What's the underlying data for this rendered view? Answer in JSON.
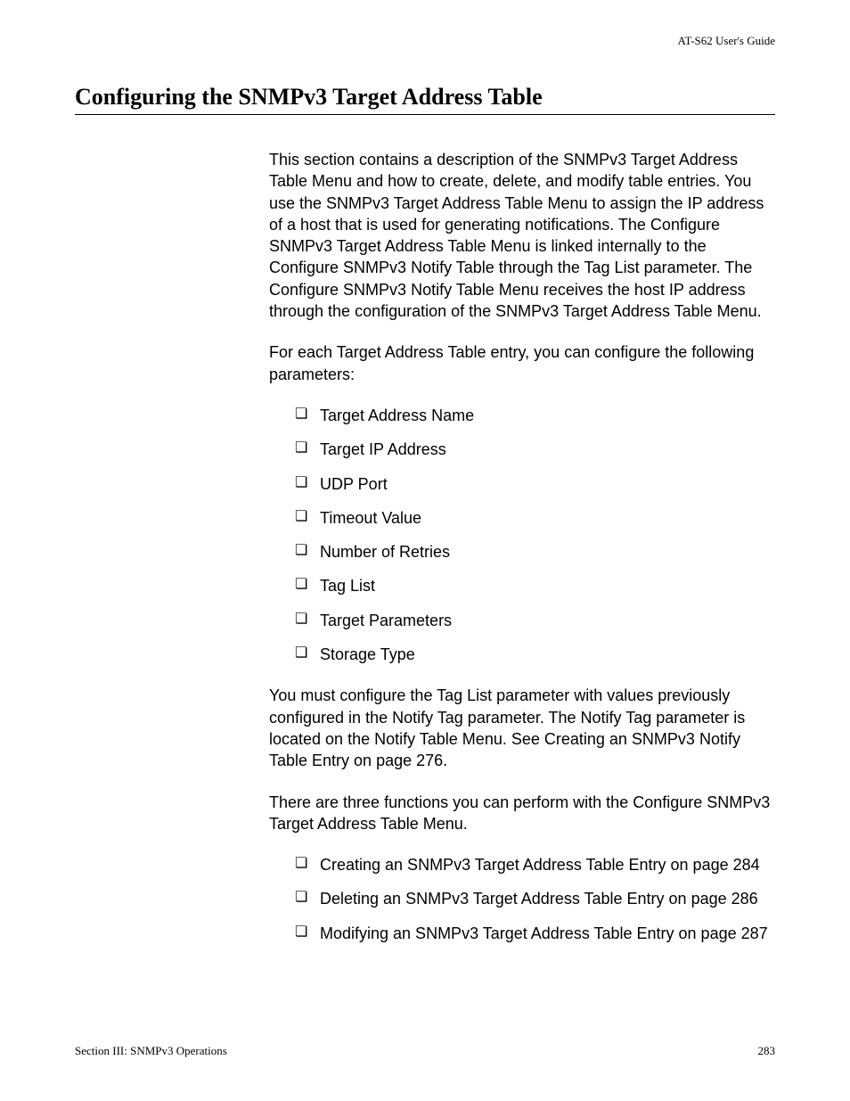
{
  "header": {
    "guide_title": "AT-S62 User's Guide"
  },
  "heading": "Configuring the SNMPv3 Target Address Table",
  "paragraphs": {
    "intro": "This section contains a description of the SNMPv3 Target Address Table Menu and how to create, delete, and modify table entries. You use the SNMPv3 Target Address Table Menu to assign the IP address of a host that is used for generating notifications. The Configure SNMPv3 Target Address Table Menu is linked internally to the Configure SNMPv3 Notify Table through the Tag List parameter. The Configure SNMPv3 Notify Table Menu receives the host IP address through the configuration of the SNMPv3 Target Address Table Menu.",
    "params_intro": "For each Target Address Table entry, you can configure the following parameters:",
    "tag_list_note": "You must configure the Tag List parameter with values previously configured in the Notify Tag parameter. The Notify Tag parameter is located on the Notify Table Menu. See Creating an SNMPv3 Notify Table Entry on page 276.",
    "functions_intro": "There are three functions you can perform with the Configure SNMPv3 Target Address Table Menu."
  },
  "params_list": [
    "Target Address Name",
    "Target IP Address",
    "UDP Port",
    "Timeout Value",
    "Number of Retries",
    "Tag List",
    "Target Parameters",
    "Storage Type"
  ],
  "functions_list": [
    "Creating an SNMPv3 Target Address Table Entry on page 284",
    "Deleting an SNMPv3 Target Address Table Entry on page 286",
    "Modifying an SNMPv3 Target Address Table Entry on page 287"
  ],
  "footer": {
    "section": "Section III: SNMPv3 Operations",
    "page": "283"
  }
}
